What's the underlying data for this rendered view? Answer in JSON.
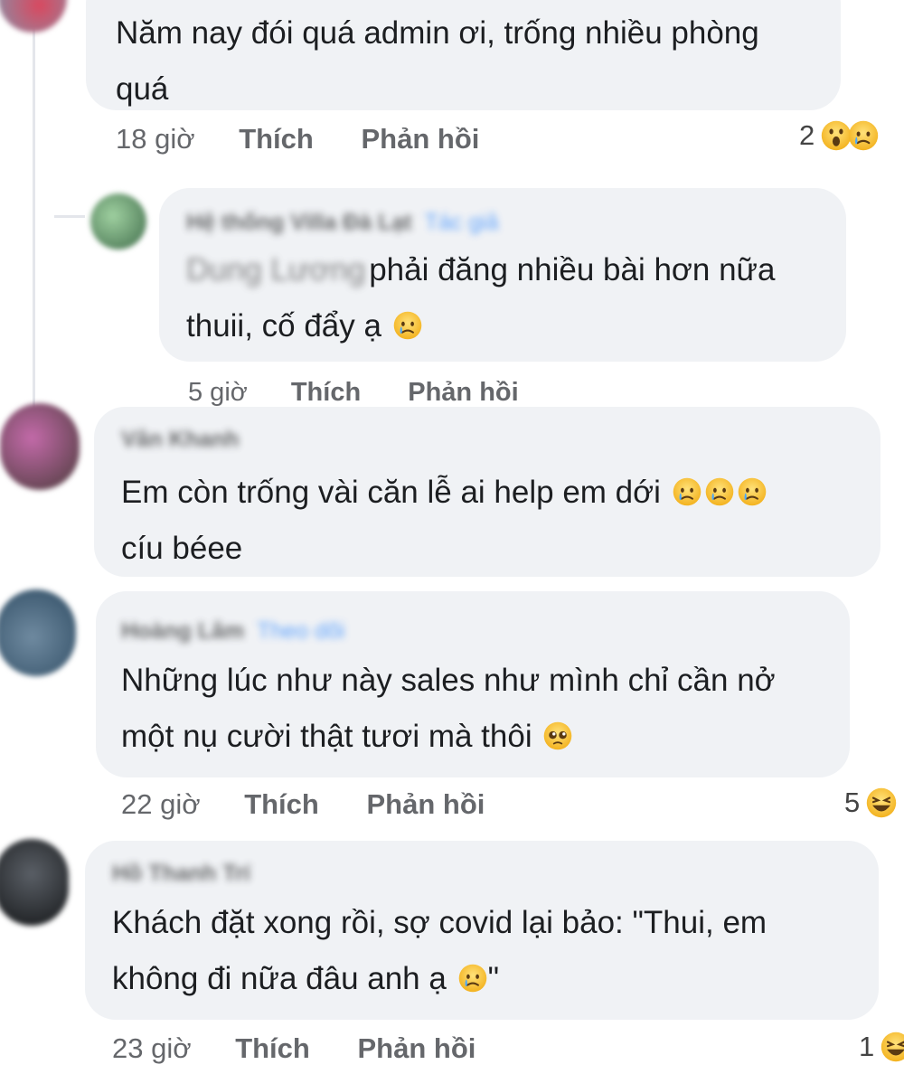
{
  "comments": [
    {
      "id": "c1",
      "text_lines": [
        "Năm nay đói quá admin ơi, trống nhiều phòng",
        "quá"
      ],
      "time": "18 giờ",
      "like_label": "Thích",
      "reply_label": "Phản hồi",
      "reaction_count": "2",
      "reaction_icons": [
        "wow-icon",
        "sad-icon"
      ]
    },
    {
      "id": "c2",
      "author": "Hệ thống Villa Đà Lạt",
      "author_badge": "Tác giả",
      "mention": "Dung Lương",
      "text_lines": [
        "phải đăng nhiều bài hơn nữa",
        "thuii, cố đẩy ạ"
      ],
      "time": "5 giờ",
      "like_label": "Thích",
      "reply_label": "Phản hồi"
    },
    {
      "id": "c3",
      "author": "Vân Khanh",
      "text_lines": [
        "Em còn trống vài căn lễ ai help em dới",
        "cíu béee"
      ],
      "emoji_after_line1": [
        "sad-icon",
        "sad-icon",
        "sad-icon"
      ]
    },
    {
      "id": "c4",
      "author": "Hoàng Lâm",
      "author_badge": "Theo dõi",
      "text_lines": [
        "Những lúc như này sales như mình chỉ cần nở",
        "một nụ cười thật tươi mà thôi"
      ],
      "time": "22 giờ",
      "like_label": "Thích",
      "reply_label": "Phản hồi",
      "reaction_count": "5",
      "reaction_icons": [
        "haha-icon"
      ]
    },
    {
      "id": "c5",
      "author": "Hồ Thanh Trí",
      "text_lines": [
        "Khách đặt xong rồi, sợ covid lại bảo: \"Thui, em",
        "không đi nữa đâu anh ạ",
        "\""
      ],
      "time": "23 giờ",
      "like_label": "Thích",
      "reply_label": "Phản hồi",
      "reaction_count": "1",
      "reaction_icons": [
        "haha-icon"
      ]
    }
  ],
  "colors": {
    "bubble": "#f0f2f5",
    "meta_text": "#65676b",
    "link_blue": "#2d88ff",
    "emoji_yellow": "#f7c238"
  }
}
